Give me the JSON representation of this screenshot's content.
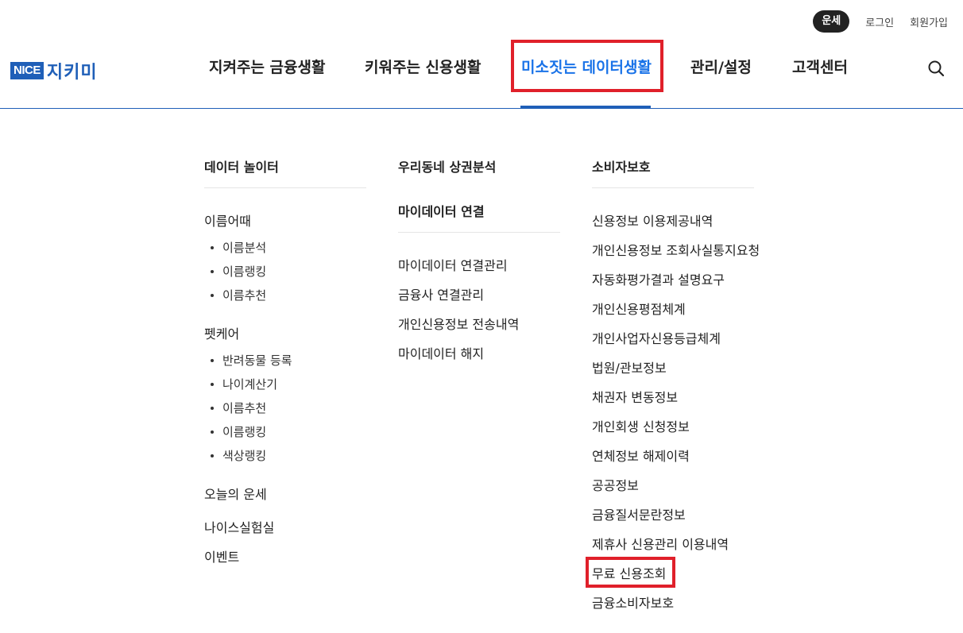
{
  "utility": {
    "fortune": "운세",
    "login": "로그인",
    "signup": "회원가입"
  },
  "logo": {
    "brand": "NICE",
    "name": "지키미"
  },
  "gnb": {
    "items": [
      "지켜주는 금융생활",
      "키워주는 신용생활",
      "미소짓는 데이터생활",
      "관리/설정",
      "고객센터"
    ],
    "active": "미소짓는 데이터생활"
  },
  "icons": {
    "search": "search-icon"
  },
  "colors": {
    "brand": "#1f5fb8",
    "active": "#1a73e8",
    "highlight": "#e0202a"
  },
  "menu": {
    "col1": {
      "title": "데이터 놀이터",
      "group1": {
        "label": "이름어때",
        "items": [
          "이름분석",
          "이름랭킹",
          "이름추천"
        ]
      },
      "group2": {
        "label": "펫케어",
        "items": [
          "반려동물 등록",
          "나이계산기",
          "이름추천",
          "이름랭킹",
          "색상랭킹"
        ]
      },
      "links": [
        "오늘의 운세",
        "나이스실험실",
        "이벤트"
      ]
    },
    "col2": {
      "title1": "우리동네 상권분석",
      "title2": "마이데이터 연결",
      "links": [
        "마이데이터 연결관리",
        "금융사 연결관리",
        "개인신용정보 전송내역",
        "마이데이터 해지"
      ]
    },
    "col3": {
      "title": "소비자보호",
      "links": [
        "신용정보 이용제공내역",
        "개인신용정보 조회사실통지요청",
        "자동화평가결과 설명요구",
        "개인신용평점체계",
        "개인사업자신용등급체계",
        "법원/관보정보",
        "채권자 변동정보",
        "개인회생 신청정보",
        "연체정보 해제이력",
        "공공정보",
        "금융질서문란정보",
        "제휴사 신용관리 이용내역",
        "무료 신용조회",
        "금융소비자보호"
      ]
    }
  }
}
